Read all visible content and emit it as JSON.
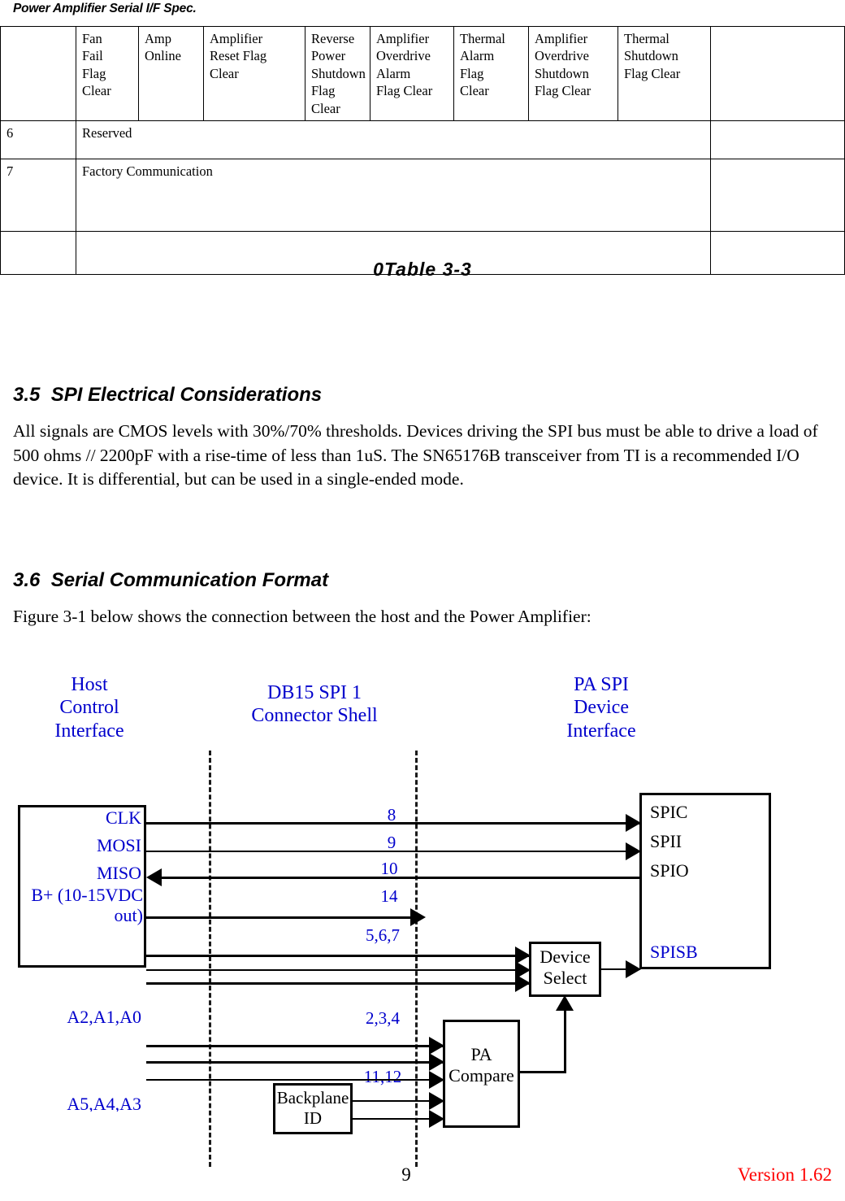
{
  "header": {
    "title": "Power Amplifier Serial I/F Spec."
  },
  "table": {
    "columns": [
      "",
      "Fan Fail Flag Clear",
      "Amp Online",
      "Amplifier Reset Flag Clear",
      "Reverse Power Shutdown Flag Clear",
      "Amplifier Overdrive Alarm Flag Clear",
      "Thermal Alarm Flag Clear",
      "Amplifier Overdrive Shutdown Flag Clear",
      "Thermal Shutdown Flag Clear",
      ""
    ],
    "rows": [
      {
        "num": "6",
        "label": "Reserved",
        "last": ""
      },
      {
        "num": "7",
        "label": "Factory Communication",
        "last": ""
      },
      {
        "num": "",
        "label": "",
        "last": ""
      }
    ]
  },
  "table_caption": "0Table 3-3",
  "sections": [
    {
      "heading": "3.5  SPI Electrical Considerations",
      "body": "All signals are CMOS levels with 30%/70% thresholds.  Devices driving the SPI bus must be able to drive a load of 500 ohms // 2200pF with a rise-time of less than 1uS.   The SN65176B transceiver from TI is a recommended I/O device.  It is differential, but can be used in a single-ended mode."
    },
    {
      "heading": "3.6  Serial Communication Format",
      "body": "Figure 3-1 below shows the connection between the host and the Power Amplifier:"
    }
  ],
  "figure": {
    "titles": {
      "host": "Host\nControl\nInterface",
      "connector": "DB15  SPI 1\nConnector Shell",
      "pa": "PA SPI\nDevice\nInterface"
    },
    "host_pins": [
      "CLK",
      "MOSI",
      "MISO",
      "B+ (10-15VDC out)",
      "A2,A1,A0",
      "A5,A4,A3"
    ],
    "pin_numbers": [
      "8",
      "9",
      "10",
      "14",
      "5,6,7",
      "2,3,4",
      "11,12"
    ],
    "pa_pins": [
      "SPIC",
      "SPII",
      "SPIO",
      "SPISB"
    ],
    "blocks": {
      "device_select": "Device\nSelect",
      "pa_compare": "PA\nCompare",
      "backplane_id": "Backplane\nID"
    },
    "colors": {
      "label_blue": "#0000cc",
      "wire_black": "#000000"
    }
  },
  "footer": {
    "page_number": "9",
    "version": "Version 1.62",
    "version_color": "#ff0000"
  }
}
